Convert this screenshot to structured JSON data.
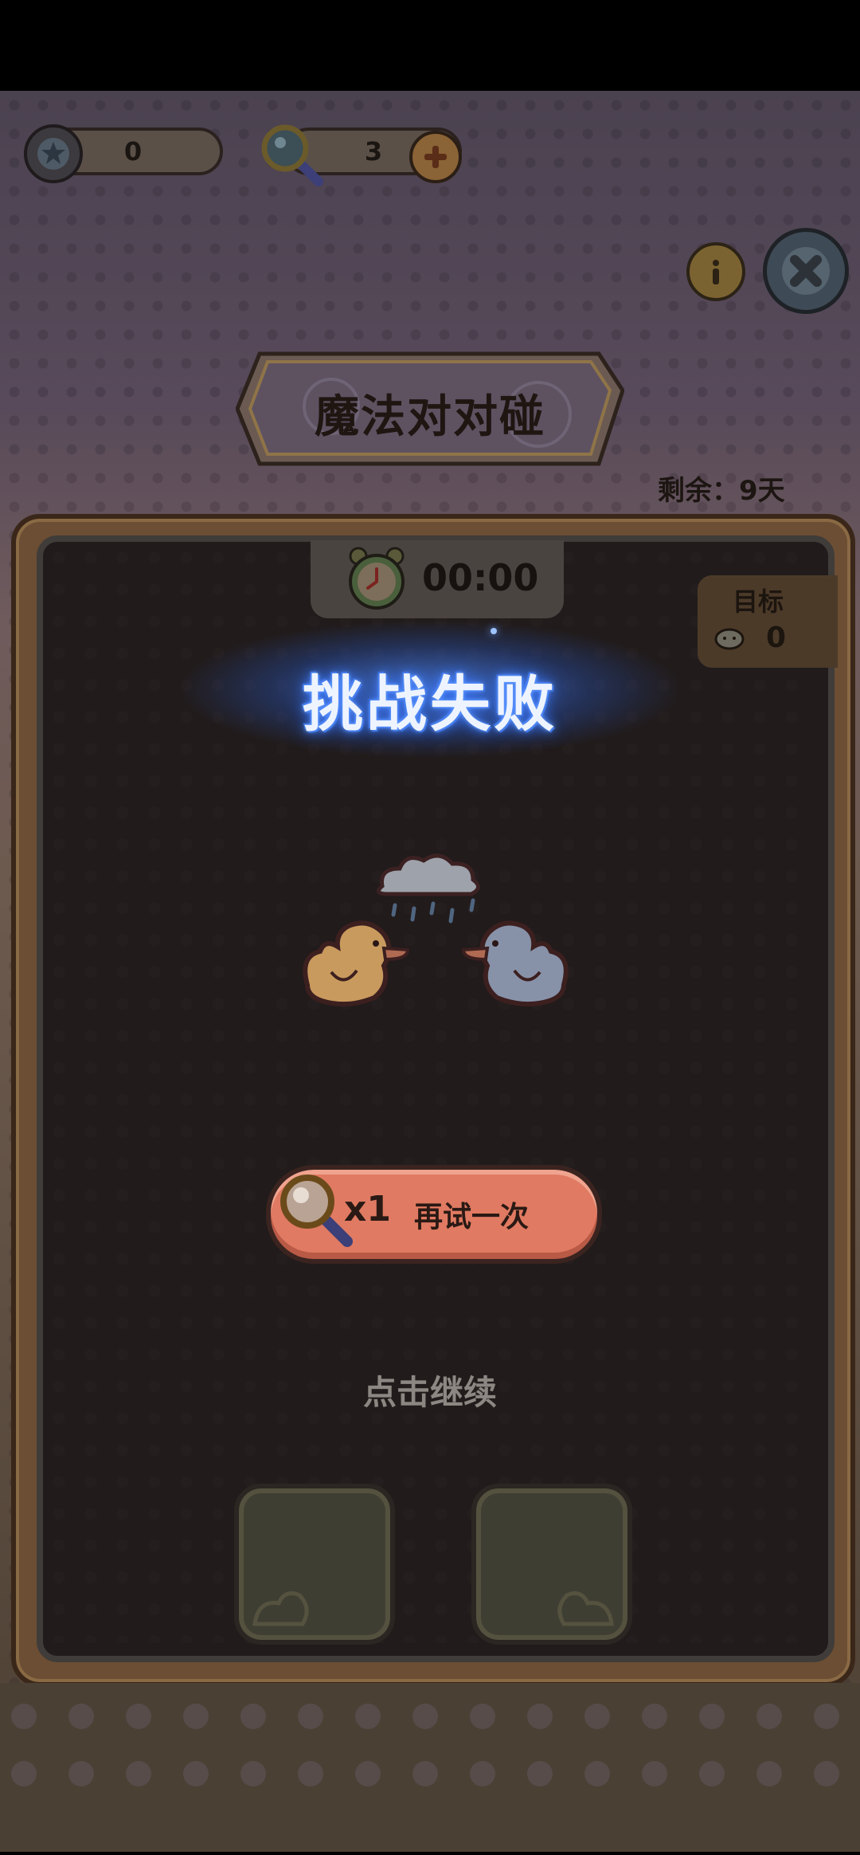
{
  "hud": {
    "stars": "0",
    "magnifiers": "3"
  },
  "header": {
    "title": "魔法对对碰",
    "remaining_label": "剩余：9天"
  },
  "timer": {
    "value": "00:00"
  },
  "goal": {
    "label": "目标",
    "count": "0"
  },
  "result": {
    "title": "挑战失败",
    "retry_cost": "x1",
    "retry_label": "再试一次",
    "continue_label": "点击继续"
  },
  "icons": {
    "star": "star-icon",
    "magnifier": "magnifier-icon",
    "plus": "plus-icon",
    "info": "info-icon",
    "close": "close-icon",
    "alarm": "alarm-clock-icon",
    "cloud": "cloud-icon"
  },
  "colors": {
    "retry_button": "#e07a62",
    "fail_glow": "#3f7bff",
    "board_frame": "#6b4e33"
  }
}
